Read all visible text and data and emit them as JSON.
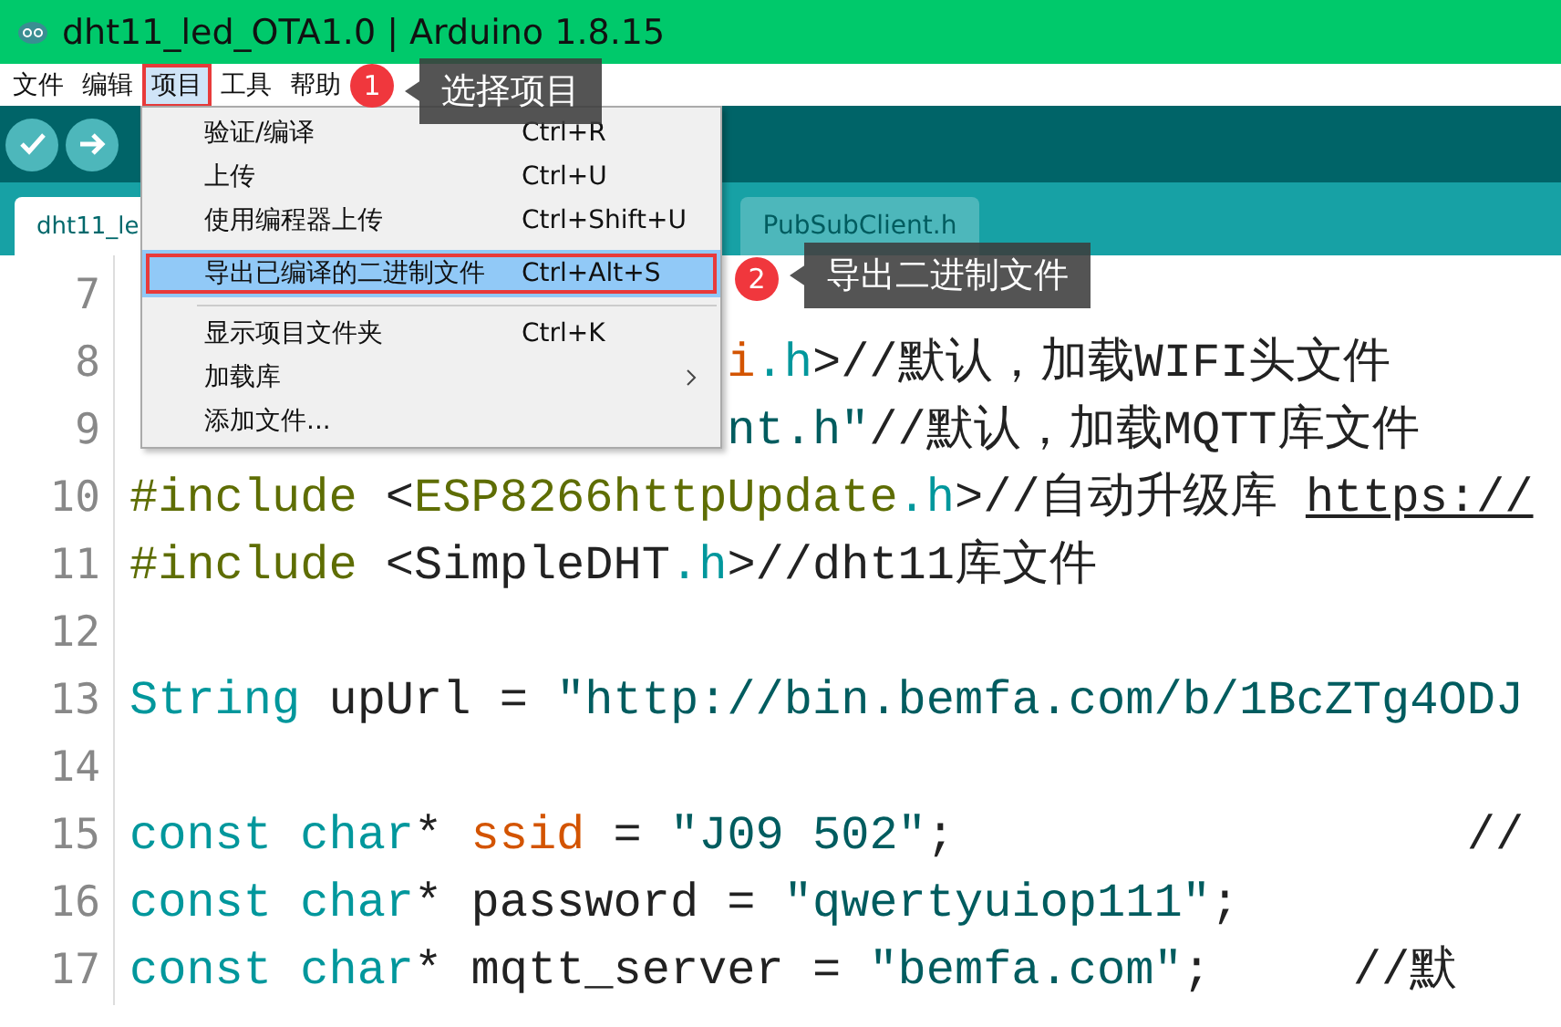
{
  "window": {
    "title": "dht11_led_OTA1.0 | Arduino 1.8.15"
  },
  "menubar": [
    {
      "label": "文件",
      "selected": false
    },
    {
      "label": "编辑",
      "selected": false
    },
    {
      "label": "项目",
      "selected": true
    },
    {
      "label": "工具",
      "selected": false
    },
    {
      "label": "帮助",
      "selected": false
    }
  ],
  "tabs": [
    {
      "label": "dht11_le",
      "selected": true
    },
    {
      "label": "PubSubClient.h",
      "selected": false
    }
  ],
  "menu": {
    "items": [
      {
        "label": "验证/编译",
        "shortcut": "Ctrl+R",
        "highlighted": false,
        "submenu": false
      },
      {
        "label": "上传",
        "shortcut": "Ctrl+U",
        "highlighted": false,
        "submenu": false
      },
      {
        "label": "使用编程器上传",
        "shortcut": "Ctrl+Shift+U",
        "highlighted": false,
        "submenu": false
      },
      {
        "label": "导出已编译的二进制文件",
        "shortcut": "Ctrl+Alt+S",
        "highlighted": true,
        "submenu": false
      },
      {
        "label": "显示项目文件夹",
        "shortcut": "Ctrl+K",
        "highlighted": false,
        "submenu": false,
        "separator_before": true
      },
      {
        "label": "加载库",
        "highlighted": false,
        "submenu": true
      },
      {
        "label": "添加文件...",
        "highlighted": false,
        "submenu": false
      }
    ]
  },
  "annotations": [
    {
      "number": "1",
      "text": "选择项目"
    },
    {
      "number": "2",
      "text": "导出二进制文件"
    }
  ],
  "editor": {
    "lines": [
      {
        "number": "7"
      },
      {
        "number": "8",
        "tokens": [
          {
            "kind": "covered_tail_orange",
            "text": "i"
          },
          {
            "kind": "teal",
            "text": ".h"
          },
          {
            "kind": "plain",
            "text": ">//默认，加载WIFI头文件"
          }
        ]
      },
      {
        "number": "9",
        "tokens": [
          {
            "kind": "covered_tail_teal",
            "text": "nt.h\""
          },
          {
            "kind": "plain",
            "text": "//默认，加载MQTT库文件"
          }
        ]
      },
      {
        "number": "10",
        "tokens": [
          {
            "kind": "prep",
            "text": "#include"
          },
          {
            "kind": "plain",
            "text": " <"
          },
          {
            "kind": "lib",
            "text": "ESP8266httpUpdate"
          },
          {
            "kind": "teal",
            "text": ".h"
          },
          {
            "kind": "plain",
            "text": ">//自动升级库 "
          },
          {
            "kind": "link",
            "text": "https://"
          }
        ]
      },
      {
        "number": "11",
        "tokens": [
          {
            "kind": "prep",
            "text": "#include"
          },
          {
            "kind": "plain",
            "text": " <SimpleDHT"
          },
          {
            "kind": "teal",
            "text": ".h"
          },
          {
            "kind": "plain",
            "text": ">//dht11库文件"
          }
        ]
      },
      {
        "number": "12"
      },
      {
        "number": "13",
        "tokens": [
          {
            "kind": "teal",
            "text": "String"
          },
          {
            "kind": "plain",
            "text": " upUrl = "
          },
          {
            "kind": "str",
            "text": "\"http://bin.bemfa.com/b/1BcZTg4ODJ"
          }
        ]
      },
      {
        "number": "14"
      },
      {
        "number": "15",
        "tokens": [
          {
            "kind": "teal",
            "text": "const char"
          },
          {
            "kind": "plain",
            "text": "* "
          },
          {
            "kind": "orange",
            "text": "ssid"
          },
          {
            "kind": "plain",
            "text": " = "
          },
          {
            "kind": "str",
            "text": "\"J09 502\""
          },
          {
            "kind": "plain",
            "text": ";                  //"
          }
        ]
      },
      {
        "number": "16",
        "tokens": [
          {
            "kind": "teal",
            "text": "const char"
          },
          {
            "kind": "plain",
            "text": "* password = "
          },
          {
            "kind": "str",
            "text": "\"qwertyuiop111\""
          },
          {
            "kind": "plain",
            "text": ";"
          }
        ]
      },
      {
        "number": "17",
        "tokens": [
          {
            "kind": "teal",
            "text": "const char"
          },
          {
            "kind": "plain",
            "text": "* mqtt_server = "
          },
          {
            "kind": "str",
            "text": "\"bemfa.com\""
          },
          {
            "kind": "plain",
            "text": ";     //默"
          }
        ]
      }
    ]
  }
}
